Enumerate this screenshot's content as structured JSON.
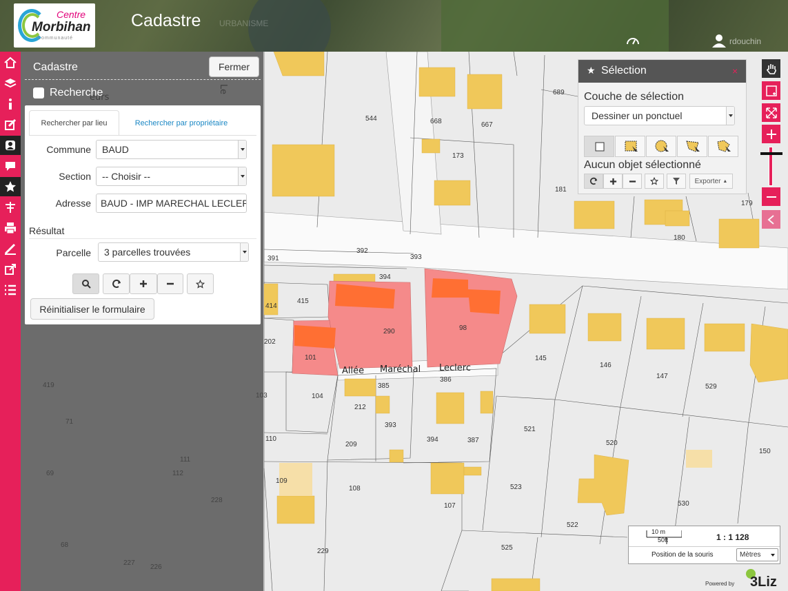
{
  "header": {
    "logo_top": "Centre",
    "logo_main": "Morbihan",
    "logo_sub": "Communauté",
    "title": "Cadastre",
    "ghost_text": "URBANISME",
    "user_name": "rdouchin"
  },
  "nav": [
    "home-icon",
    "layers-icon",
    "info-icon",
    "edit-icon",
    "cadastre-icon",
    "comment-icon",
    "star-icon",
    "measure-icon",
    "print-icon",
    "draw-icon",
    "share-icon",
    "list-icon"
  ],
  "cadastre": {
    "title": "Cadastre",
    "close_label": "Fermer",
    "search_title": "Recherche",
    "tabs": [
      "Rechercher par lieu",
      "Rechercher par propriétaire"
    ],
    "fields": {
      "commune_label": "Commune",
      "commune_value": "BAUD",
      "section_label": "Section",
      "section_value": "-- Choisir --",
      "adresse_label": "Adresse",
      "adresse_value": "BAUD - IMP MARECHAL LECLERC"
    },
    "result_title": "Résultat",
    "parcelle_label": "Parcelle",
    "parcelle_value": "3 parcelles trouvées",
    "reset_label": "Réinitialiser le formulaire"
  },
  "selection": {
    "title": "Sélection",
    "close": "×",
    "couche_label": "Couche de sélection",
    "draw_value": "Dessiner un ponctuel",
    "status": "Aucun objet sélectionné",
    "export_label": "Exporter"
  },
  "map": {
    "street": [
      "Allée",
      "Maréchal",
      "Leclerc"
    ],
    "street_partial": "Le",
    "street_partial2": "eurs",
    "parcel_numbers": [
      "544",
      "668",
      "667",
      "689",
      "173",
      "181",
      "179",
      "180",
      "392",
      "393",
      "391",
      "394",
      "415",
      "414",
      "290",
      "98",
      "202",
      "101",
      "145",
      "146",
      "147",
      "529",
      "386",
      "385",
      "419",
      "103",
      "104",
      "212",
      "393",
      "394",
      "387",
      "521",
      "520",
      "150",
      "110",
      "209",
      "71",
      "111",
      "112",
      "69",
      "109",
      "108",
      "107",
      "523",
      "530",
      "228",
      "522",
      "68",
      "229",
      "525",
      "227",
      "226"
    ]
  },
  "scale": {
    "meters": "10 m",
    "feet": "50ft",
    "ratio": "1 : 1 128",
    "mouse_label": "Position de la souris",
    "units": "Mètres"
  },
  "footer": {
    "powered_by": "Powered by",
    "brand": "3Liz"
  },
  "colors": {
    "accent": "#e6205a",
    "building": "#f0c85a",
    "selected_parcel": "#f58a8a",
    "selected_building": "#ff6f33"
  }
}
